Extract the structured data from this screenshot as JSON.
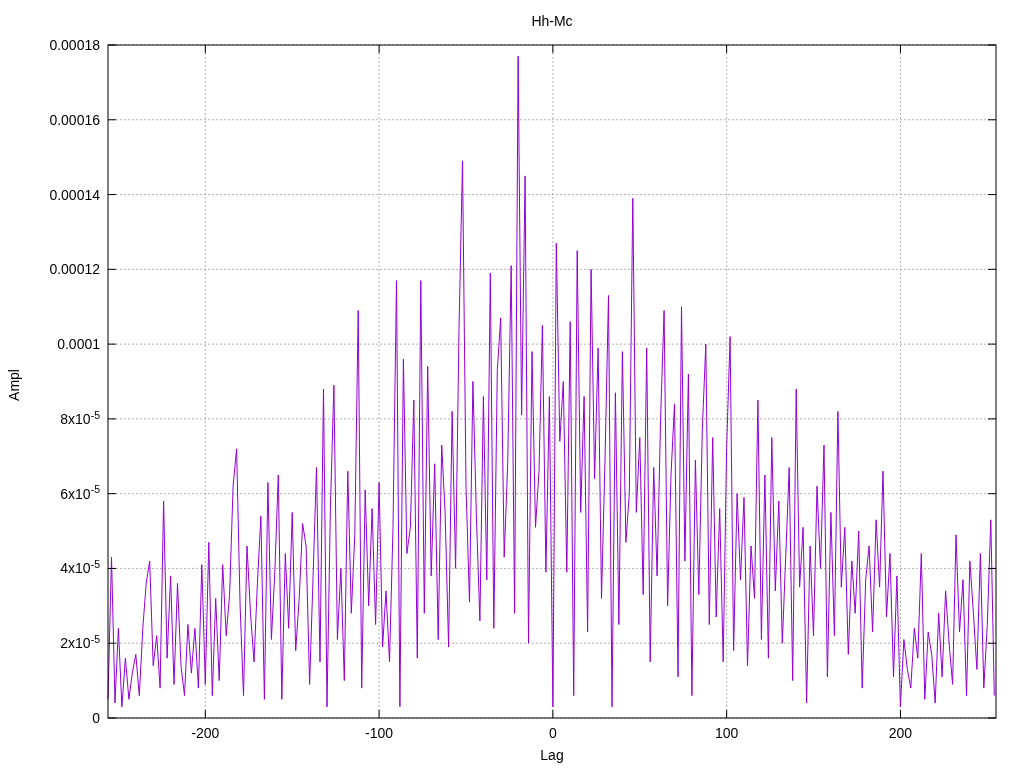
{
  "chart_data": {
    "type": "line",
    "title": "Hh-Mc",
    "xlabel": "Lag",
    "ylabel": "Ampl",
    "xlim": [
      -256,
      255
    ],
    "ylim": [
      0,
      0.00018
    ],
    "grid": true,
    "xticks": [
      {
        "value": -200,
        "label": "-200"
      },
      {
        "value": -100,
        "label": "-100"
      },
      {
        "value": 0,
        "label": "0"
      },
      {
        "value": 100,
        "label": "100"
      },
      {
        "value": 200,
        "label": "200"
      }
    ],
    "yticks": [
      {
        "value": 0,
        "label": "0"
      },
      {
        "value": 2e-05,
        "label": "2x10$^{-5}$"
      },
      {
        "value": 4e-05,
        "label": "4x10$^{-5}$"
      },
      {
        "value": 6e-05,
        "label": "6x10$^{-5}$"
      },
      {
        "value": 8e-05,
        "label": "8x10$^{-5}$"
      },
      {
        "value": 0.0001,
        "label": "0.0001"
      },
      {
        "value": 0.00012,
        "label": "0.00012"
      },
      {
        "value": 0.00014,
        "label": "0.00014"
      },
      {
        "value": 0.00016,
        "label": "0.00016"
      },
      {
        "value": 0.00018,
        "label": "0.00018"
      }
    ],
    "x": [
      -256,
      -254,
      -252,
      -250,
      -248,
      -246,
      -244,
      -242,
      -240,
      -238,
      -236,
      -234,
      -232,
      -230,
      -228,
      -226,
      -224,
      -222,
      -220,
      -218,
      -216,
      -214,
      -212,
      -210,
      -208,
      -206,
      -204,
      -202,
      -200,
      -198,
      -196,
      -194,
      -192,
      -190,
      -188,
      -186,
      -184,
      -182,
      -180,
      -178,
      -176,
      -174,
      -172,
      -170,
      -168,
      -166,
      -164,
      -162,
      -160,
      -158,
      -156,
      -154,
      -152,
      -150,
      -148,
      -146,
      -144,
      -142,
      -140,
      -138,
      -136,
      -134,
      -132,
      -130,
      -128,
      -126,
      -124,
      -122,
      -120,
      -118,
      -116,
      -114,
      -112,
      -110,
      -108,
      -106,
      -104,
      -102,
      -100,
      -98,
      -96,
      -94,
      -92,
      -90,
      -88,
      -86,
      -84,
      -82,
      -80,
      -78,
      -76,
      -74,
      -72,
      -70,
      -68,
      -66,
      -64,
      -62,
      -60,
      -58,
      -56,
      -54,
      -52,
      -50,
      -48,
      -46,
      -44,
      -42,
      -40,
      -38,
      -36,
      -34,
      -32,
      -30,
      -28,
      -26,
      -24,
      -22,
      -20,
      -18,
      -16,
      -14,
      -12,
      -10,
      -8,
      -6,
      -4,
      -2,
      0,
      2,
      4,
      6,
      8,
      10,
      12,
      14,
      16,
      18,
      20,
      22,
      24,
      26,
      28,
      30,
      32,
      34,
      36,
      38,
      40,
      42,
      44,
      46,
      48,
      50,
      52,
      54,
      56,
      58,
      60,
      62,
      64,
      66,
      68,
      70,
      72,
      74,
      76,
      78,
      80,
      82,
      84,
      86,
      88,
      90,
      92,
      94,
      96,
      98,
      100,
      102,
      104,
      106,
      108,
      110,
      112,
      114,
      116,
      118,
      120,
      122,
      124,
      126,
      128,
      130,
      132,
      134,
      136,
      138,
      140,
      142,
      144,
      146,
      148,
      150,
      152,
      154,
      156,
      158,
      160,
      162,
      164,
      166,
      168,
      170,
      172,
      174,
      176,
      178,
      180,
      182,
      184,
      186,
      188,
      190,
      192,
      194,
      196,
      198,
      200,
      202,
      204,
      206,
      208,
      210,
      212,
      214,
      216,
      218,
      220,
      222,
      224,
      226,
      228,
      230,
      232,
      234,
      236,
      238,
      240,
      242,
      244,
      246,
      248,
      250,
      252,
      254
    ],
    "series": [
      {
        "color": "#9400d3",
        "values": [
          5e-06,
          4.3e-05,
          4e-06,
          2.4e-05,
          3e-06,
          1.6e-05,
          5e-06,
          1.2e-05,
          1.7e-05,
          6e-06,
          2.4e-05,
          3.6e-05,
          4.2e-05,
          1.4e-05,
          2.2e-05,
          8e-06,
          5.8e-05,
          1.6e-05,
          3.8e-05,
          9e-06,
          3.6e-05,
          1.4e-05,
          6e-06,
          2.5e-05,
          1.2e-05,
          2.4e-05,
          8e-06,
          4.1e-05,
          9e-06,
          4.7e-05,
          6e-06,
          3.2e-05,
          1e-05,
          4.1e-05,
          2.2e-05,
          3.3e-05,
          6.2e-05,
          7.2e-05,
          3e-05,
          6e-06,
          4.6e-05,
          2.8e-05,
          1.5e-05,
          3.6e-05,
          5.4e-05,
          5e-06,
          6.3e-05,
          2.1e-05,
          3.9e-05,
          6.5e-05,
          5e-06,
          4.4e-05,
          2.4e-05,
          5.5e-05,
          1.8e-05,
          3.2e-05,
          5.2e-05,
          4.6e-05,
          9e-06,
          3.8e-05,
          6.7e-05,
          1.5e-05,
          8.8e-05,
          3e-06,
          5.6e-05,
          8.9e-05,
          2.1e-05,
          4e-05,
          1e-05,
          6.6e-05,
          2.8e-05,
          4.9e-05,
          0.000109,
          8e-06,
          6.1e-05,
          3e-05,
          5.6e-05,
          2.5e-05,
          6.3e-05,
          1.9e-05,
          3.4e-05,
          1.5e-05,
          5.1e-05,
          0.000117,
          3e-06,
          9.6e-05,
          4.4e-05,
          5.1e-05,
          8.5e-05,
          1.6e-05,
          0.000117,
          2.8e-05,
          9.4e-05,
          3.8e-05,
          6.8e-05,
          2.1e-05,
          7.3e-05,
          5.5e-05,
          1.9e-05,
          8.2e-05,
          4e-05,
          0.000104,
          0.000149,
          6.2e-05,
          3.1e-05,
          9e-05,
          5.4e-05,
          2.6e-05,
          8.6e-05,
          3.7e-05,
          0.000119,
          2.4e-05,
          9.3e-05,
          0.000107,
          4.3e-05,
          6.8e-05,
          0.000121,
          2.8e-05,
          0.000177,
          8.1e-05,
          0.000145,
          2e-05,
          9.8e-05,
          5.1e-05,
          6.6e-05,
          0.000105,
          3.9e-05,
          8.6e-05,
          3e-06,
          0.000127,
          7.4e-05,
          9e-05,
          3.9e-05,
          0.000106,
          6e-06,
          0.000125,
          5.5e-05,
          8.6e-05,
          2.3e-05,
          0.00012,
          6.4e-05,
          9.9e-05,
          3.2e-05,
          6.9e-05,
          0.000113,
          3e-06,
          8.7e-05,
          2.5e-05,
          9.8e-05,
          4.7e-05,
          6e-05,
          0.000139,
          5.5e-05,
          7.5e-05,
          3.3e-05,
          9.9e-05,
          1.5e-05,
          6.7e-05,
          3.8e-05,
          8e-05,
          0.000109,
          3e-05,
          6.5e-05,
          8.4e-05,
          1.1e-05,
          0.00011,
          4.2e-05,
          9.2e-05,
          6e-06,
          6.9e-05,
          3.3e-05,
          7.7e-05,
          0.0001,
          2.5e-05,
          7.5e-05,
          2.7e-05,
          5.6e-05,
          1.5e-05,
          7.2e-05,
          0.000102,
          1.8e-05,
          6e-05,
          3.7e-05,
          5.9e-05,
          1.4e-05,
          4.6e-05,
          3.2e-05,
          8.5e-05,
          2.1e-05,
          6.5e-05,
          1.6e-05,
          7.5e-05,
          3.4e-05,
          5.8e-05,
          2e-05,
          4.3e-05,
          6.7e-05,
          1e-05,
          8.8e-05,
          3.5e-05,
          5.1e-05,
          4e-06,
          4.6e-05,
          2.2e-05,
          6.2e-05,
          4e-05,
          7.3e-05,
          1.1e-05,
          5.5e-05,
          2.2e-05,
          8.2e-05,
          3.5e-05,
          5.1e-05,
          1.7e-05,
          4.2e-05,
          2.8e-05,
          5e-05,
          8e-06,
          3.7e-05,
          4.6e-05,
          2.3e-05,
          5.3e-05,
          3.5e-05,
          6.6e-05,
          2.7e-05,
          4.4e-05,
          1.1e-05,
          3.8e-05,
          3e-06,
          2.1e-05,
          1.3e-05,
          8e-06,
          2.4e-05,
          1.6e-05,
          4.4e-05,
          5e-06,
          2.3e-05,
          1.7e-05,
          4e-06,
          2.8e-05,
          1.1e-05,
          3.4e-05,
          2e-05,
          9e-06,
          4.9e-05,
          2.3e-05,
          3.7e-05,
          6e-06,
          4.2e-05,
          2.8e-05,
          1.3e-05,
          4.4e-05,
          8e-06,
          2.5e-05,
          5.3e-05,
          6e-06
        ]
      }
    ]
  }
}
